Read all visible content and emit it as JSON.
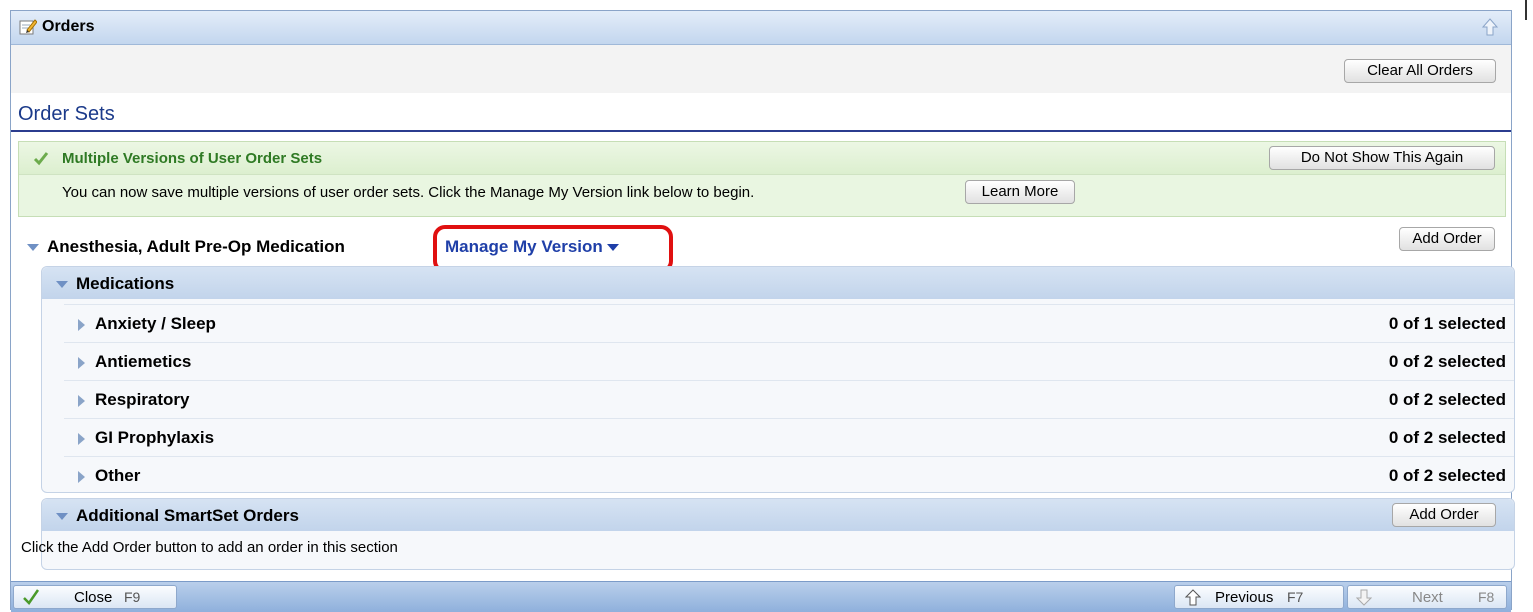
{
  "window": {
    "title": "Orders"
  },
  "toolbar": {
    "clear_all_label": "Clear All Orders"
  },
  "section": {
    "title": "Order Sets"
  },
  "notice": {
    "title": "Multiple Versions of User Order Sets",
    "dismiss_label": "Do Not Show This Again",
    "text": "You can now save multiple versions of user order sets. Click the Manage My Version link below to begin.",
    "learn_more_label": "Learn More"
  },
  "order_set": {
    "name": "Anesthesia, Adult Pre-Op Medication",
    "manage_label": "Manage My Version",
    "add_order_label": "Add Order"
  },
  "medications": {
    "title": "Medications",
    "items": [
      {
        "name": "Anxiety / Sleep",
        "count": "0 of 1 selected"
      },
      {
        "name": "Antiemetics",
        "count": "0 of 2 selected"
      },
      {
        "name": "Respiratory",
        "count": "0 of 2 selected"
      },
      {
        "name": "GI Prophylaxis",
        "count": "0 of 2 selected"
      },
      {
        "name": "Other",
        "count": "0 of 2 selected"
      }
    ]
  },
  "additional": {
    "title": "Additional SmartSet Orders",
    "add_order_label": "Add Order",
    "hint": "Click the Add Order button to add an order in this section"
  },
  "footer": {
    "close_label": "Close",
    "close_key": "F9",
    "previous_label": "Previous",
    "previous_key": "F7",
    "next_label": "Next",
    "next_key": "F8"
  },
  "colors": {
    "accent": "#1f3fa8",
    "highlight": "#e01010",
    "notice_green": "#2f7a24"
  }
}
